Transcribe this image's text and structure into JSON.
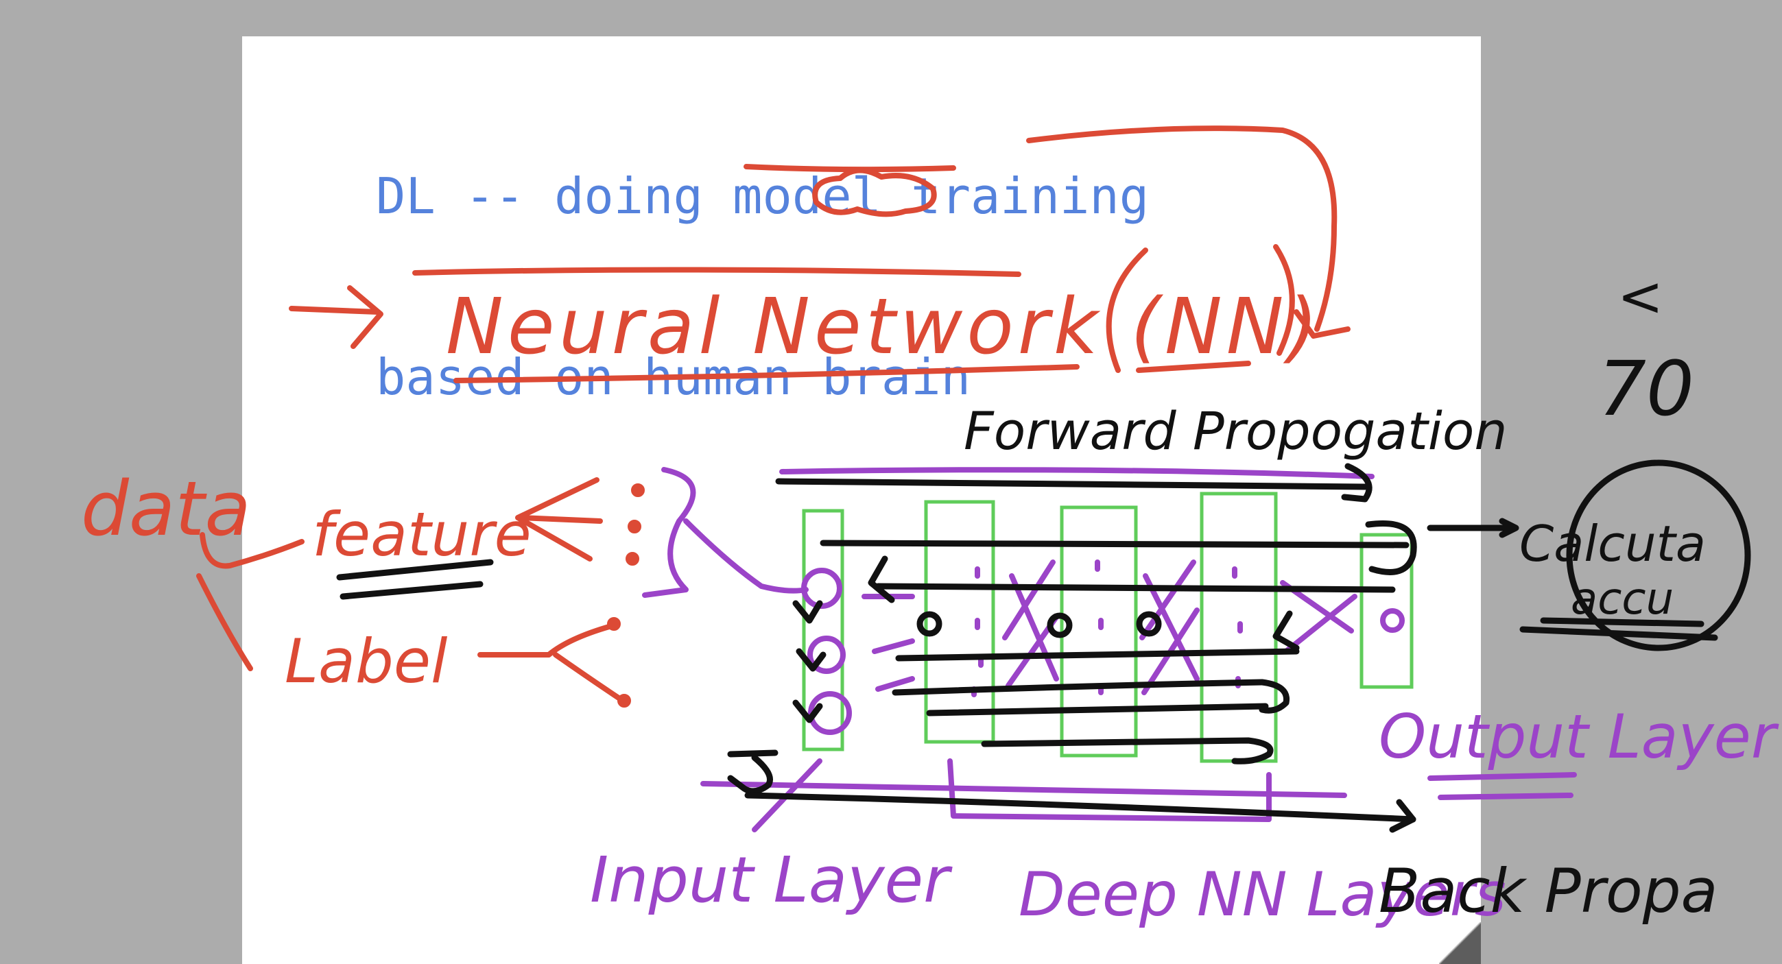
{
  "slide": {
    "typed_title": {
      "line1": "DL -- doing model training",
      "line2": "based on human brain"
    },
    "handwriting": {
      "neural_network": "Neural Network (NN)",
      "forward": "Forward Propogation",
      "data": "data",
      "feature": "feature",
      "label": "Label",
      "calc_line1": "Calcuta",
      "calc_line2": "accu",
      "lt": "<",
      "seventy": "70",
      "output_layer": "Output Layer",
      "input_layer": "Input Layer",
      "deep_layers": "Deep NN Layers",
      "back_prop": "Back Propa"
    }
  },
  "colors": {
    "background": "#acacac",
    "page": "#ffffff",
    "typed_blue": "#5582dc",
    "ink_red": "#dc4a35",
    "ink_purple": "#9b44c8",
    "ink_black": "#111111",
    "box_green": "#5fcc5a"
  }
}
